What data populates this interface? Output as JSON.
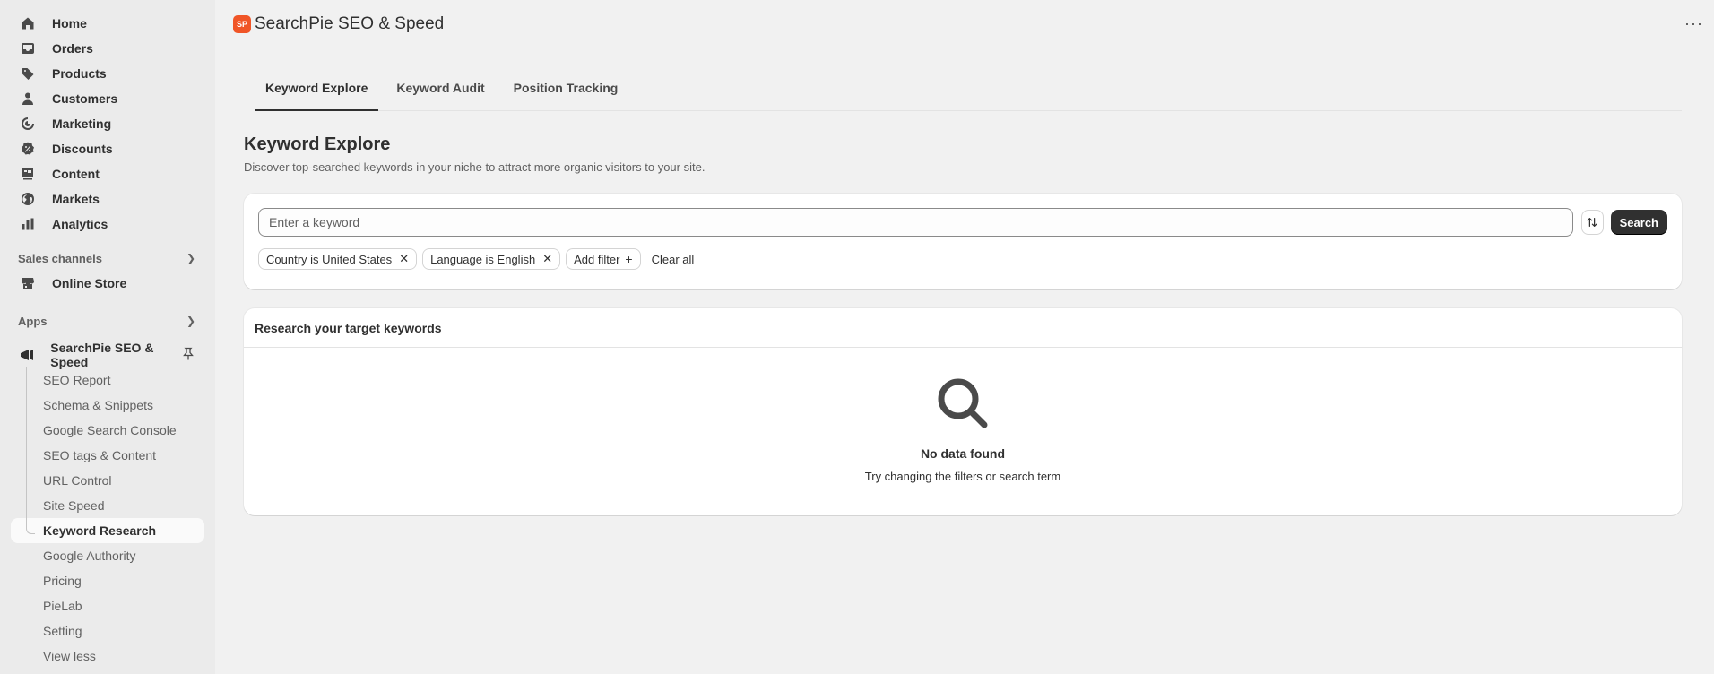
{
  "nav": {
    "items": [
      {
        "label": "Home",
        "icon": "home-icon"
      },
      {
        "label": "Orders",
        "icon": "orders-icon"
      },
      {
        "label": "Products",
        "icon": "tag-icon"
      },
      {
        "label": "Customers",
        "icon": "person-icon"
      },
      {
        "label": "Marketing",
        "icon": "target-icon"
      },
      {
        "label": "Discounts",
        "icon": "discount-icon"
      },
      {
        "label": "Content",
        "icon": "content-icon"
      },
      {
        "label": "Markets",
        "icon": "globe-icon"
      },
      {
        "label": "Analytics",
        "icon": "bar-chart-icon"
      }
    ],
    "sales_channels_label": "Sales channels",
    "online_store_label": "Online Store",
    "apps_label": "Apps",
    "app_name": "SearchPie SEO & Speed",
    "sub_items": [
      "SEO Report",
      "Schema & Snippets",
      "Google Search Console",
      "SEO tags & Content",
      "URL Control",
      "Site Speed",
      "Keyword Research",
      "Google Authority",
      "Pricing",
      "PieLab",
      "Setting",
      "View less"
    ],
    "active_sub_item": "Keyword Research"
  },
  "topbar": {
    "title": "SearchPie SEO & Speed",
    "logo_text": "SP",
    "more_label": "···"
  },
  "tabs": [
    {
      "label": "Keyword Explore",
      "active": true
    },
    {
      "label": "Keyword Audit",
      "active": false
    },
    {
      "label": "Position Tracking",
      "active": false
    }
  ],
  "page": {
    "title": "Keyword Explore",
    "subtitle": "Discover top-searched keywords in your niche to attract more organic visitors to your site."
  },
  "search": {
    "value": "",
    "placeholder": "Enter a keyword",
    "button_label": "Search"
  },
  "filters": {
    "chips": [
      "Country is United States",
      "Language is English"
    ],
    "add_label": "Add filter",
    "clear_label": "Clear all"
  },
  "results": {
    "title": "Research your target keywords",
    "empty_title": "No data found",
    "empty_subtitle": "Try changing the filters or search term"
  },
  "colors": {
    "brand_logo": "#f05527",
    "primary_button": "#303030",
    "page_background": "#f1f1f1",
    "sidebar_background": "#ebebeb"
  }
}
